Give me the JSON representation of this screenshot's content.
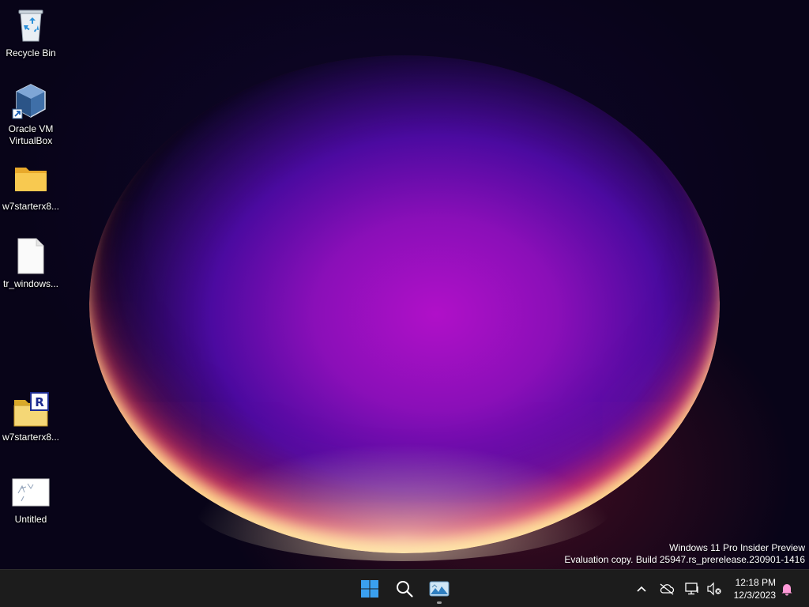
{
  "desktop": {
    "icons": [
      {
        "label": "Recycle Bin",
        "icon": "recycle-bin-icon"
      },
      {
        "label": "Oracle VM\nVirtualBox",
        "icon": "virtualbox-icon"
      },
      {
        "label": "w7starterx8...",
        "icon": "folder-icon"
      },
      {
        "label": "tr_windows...",
        "icon": "blank-file-icon"
      },
      {
        "label": "w7starterx8...",
        "icon": "winrar-archive-icon"
      },
      {
        "label": "Untitled",
        "icon": "image-file-icon"
      }
    ],
    "watermark": {
      "line1": "Windows 11 Pro Insider Preview",
      "line2": "Evaluation copy. Build 25947.rs_prerelease.230901-1416"
    }
  },
  "taskbar": {
    "pinned": [
      {
        "name": "start",
        "icon": "windows-logo-icon"
      },
      {
        "name": "search",
        "icon": "search-icon"
      },
      {
        "name": "photos",
        "icon": "photos-app-icon"
      }
    ],
    "tray": {
      "icons": [
        "chevron-up-icon",
        "cloud-offline-icon",
        "network-icon",
        "volume-muted-icon"
      ],
      "time": "12:18 PM",
      "date": "12/3/2023",
      "notification_icon": "bell-icon"
    }
  },
  "colors": {
    "taskbar": "#1c1c1c",
    "start_blue": "#3aa0f0",
    "orb_magenta": "#b010c8"
  }
}
